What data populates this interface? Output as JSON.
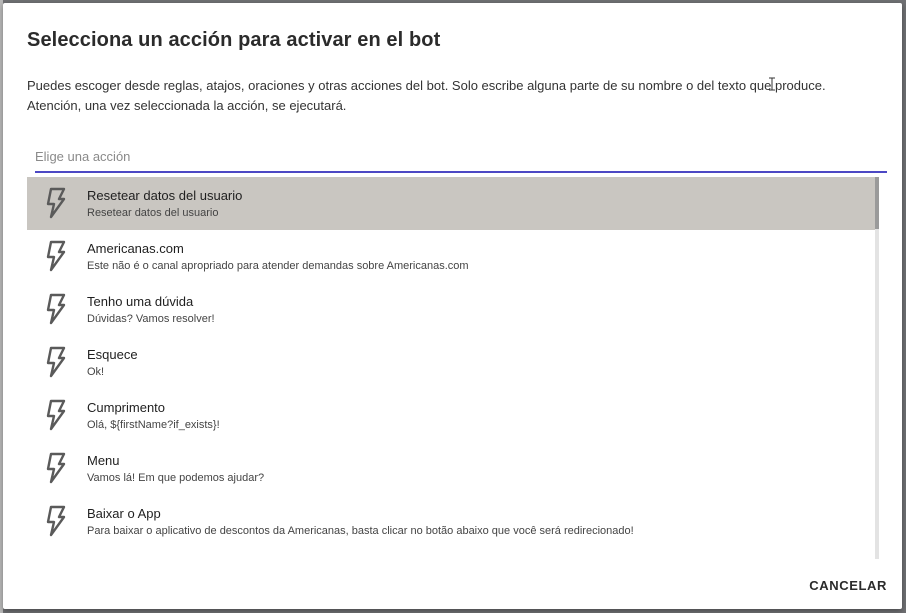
{
  "dialog": {
    "title": "Selecciona un acción para activar en el bot",
    "description_line1": "Puedes escoger desde reglas, atajos, oraciones y otras acciones del bot. Solo escribe alguna parte de su nombre o del texto que produce.",
    "description_line2": "Atención, una vez seleccionada la acción, se ejecutará.",
    "search": {
      "placeholder": "Elige una acción",
      "value": ""
    },
    "actions": [
      {
        "label": "Resetear datos del usuario",
        "sub": "Resetear datos del usuario",
        "icon": "lightning-icon",
        "selected": true
      },
      {
        "label": "Americanas.com",
        "sub": "Este não é o canal apropriado para atender demandas sobre Americanas.com",
        "icon": "lightning-icon",
        "selected": false
      },
      {
        "label": "Tenho uma dúvida",
        "sub": "Dúvidas? Vamos resolver!",
        "icon": "lightning-icon",
        "selected": false
      },
      {
        "label": "Esquece",
        "sub": "Ok!",
        "icon": "lightning-icon",
        "selected": false
      },
      {
        "label": "Cumprimento",
        "sub": "Olá, ${firstName?if_exists}!",
        "icon": "lightning-icon",
        "selected": false
      },
      {
        "label": "Menu",
        "sub": "Vamos lá! Em que podemos ajudar?",
        "icon": "lightning-icon",
        "selected": false
      },
      {
        "label": "Baixar o App",
        "sub": "Para baixar o aplicativo de descontos da Americanas, basta clicar no botão abaixo que você será redirecionado!",
        "icon": "lightning-icon",
        "selected": false
      }
    ],
    "cancel_label": "CANCELAR"
  },
  "colors": {
    "accent": "#4c48c4",
    "selected_row": "#c9c6c1"
  }
}
